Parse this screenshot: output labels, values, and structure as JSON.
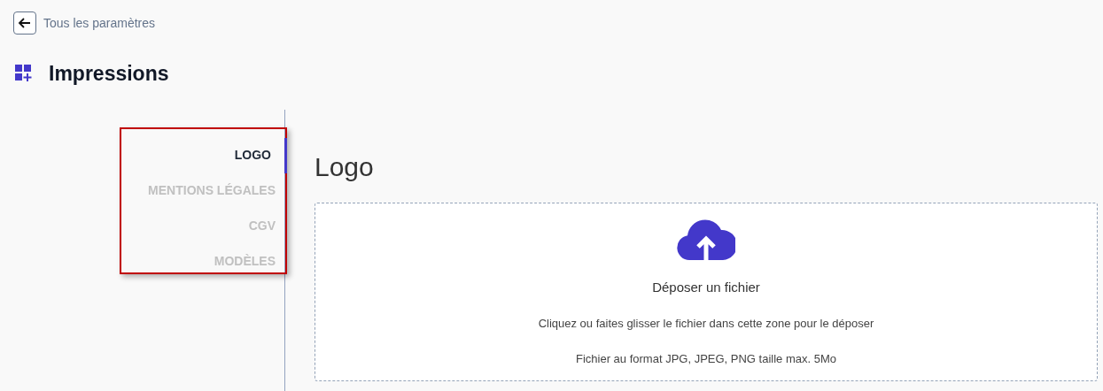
{
  "back_link": {
    "label": "Tous les paramètres"
  },
  "page_title": "Impressions",
  "nav": [
    {
      "label": "LOGO",
      "selected": true
    },
    {
      "label": "MENTIONS LÉGALES",
      "selected": false
    },
    {
      "label": "CGV",
      "selected": false
    },
    {
      "label": "MODÈLES",
      "selected": false
    }
  ],
  "section_title": "Logo",
  "dropzone": {
    "title": "Déposer un fichier",
    "hint": "Cliquez ou faites glisser le fichier dans cette zone pour le déposer",
    "formats": "Fichier au format JPG, JPEG, PNG taille max. 5Mo"
  }
}
